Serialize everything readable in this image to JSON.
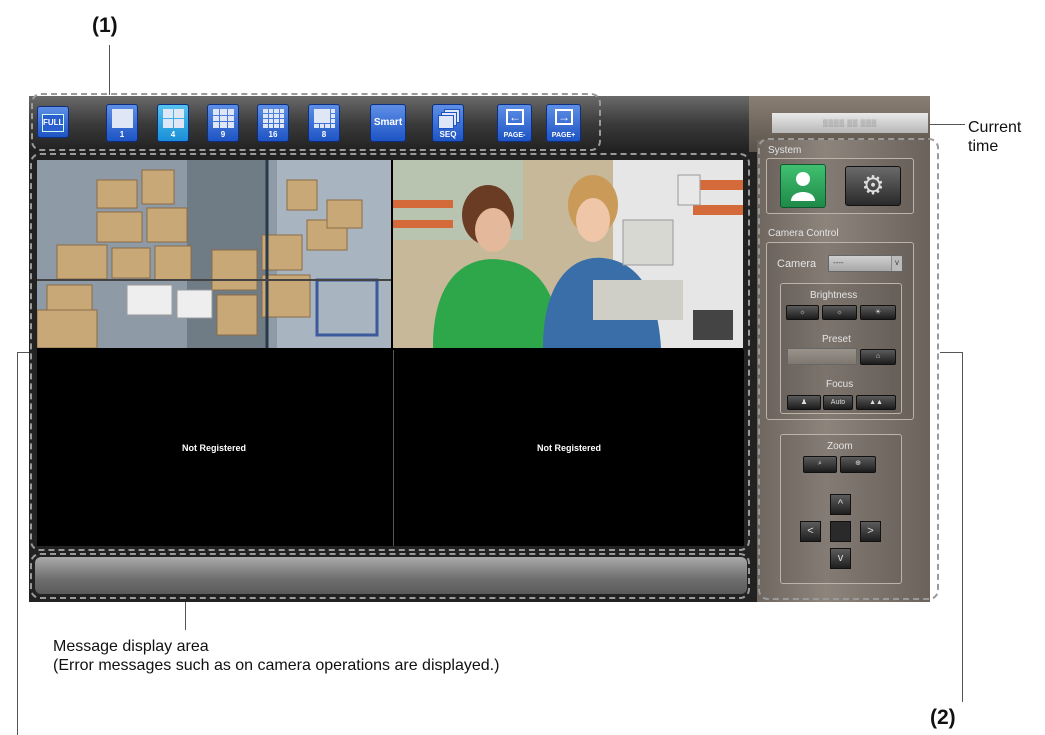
{
  "callouts": {
    "c1": "(1)",
    "c2": "(2)",
    "current_time": "Current\ntime",
    "message_area_title": "Message display area",
    "message_area_desc": "(Error messages such as on camera operations are displayed.)"
  },
  "toolbar": {
    "full": "FULL",
    "layout_1": "1",
    "layout_4": "4",
    "layout_9": "9",
    "layout_16": "16",
    "layout_8": "8",
    "smart": "Smart",
    "seq": "SEQ",
    "page_prev": "PAGE-",
    "page_next": "PAGE+",
    "selected_layout": "4"
  },
  "video_tiles": [
    {
      "label": ""
    },
    {
      "label": ""
    },
    {
      "label": "Not Registered"
    },
    {
      "label": "Not Registered"
    }
  ],
  "side_panel": {
    "system_label": "System",
    "camera_control_label": "Camera Control",
    "camera_label": "Camera",
    "camera_value": "----",
    "camera_arrow": "v",
    "brightness_label": "Brightness",
    "preset_label": "Preset",
    "focus_label": "Focus",
    "focus_auto": "Auto",
    "zoom_label": "Zoom",
    "dir_up": "^",
    "dir_left": "<",
    "dir_right": ">",
    "dir_down": "v"
  },
  "colors": {
    "toolbar_button": "#1e54c4",
    "toolbar_button_active": "#1a8fd8",
    "user_button": "#2aa35b",
    "panel_bg": "#7d746c"
  }
}
